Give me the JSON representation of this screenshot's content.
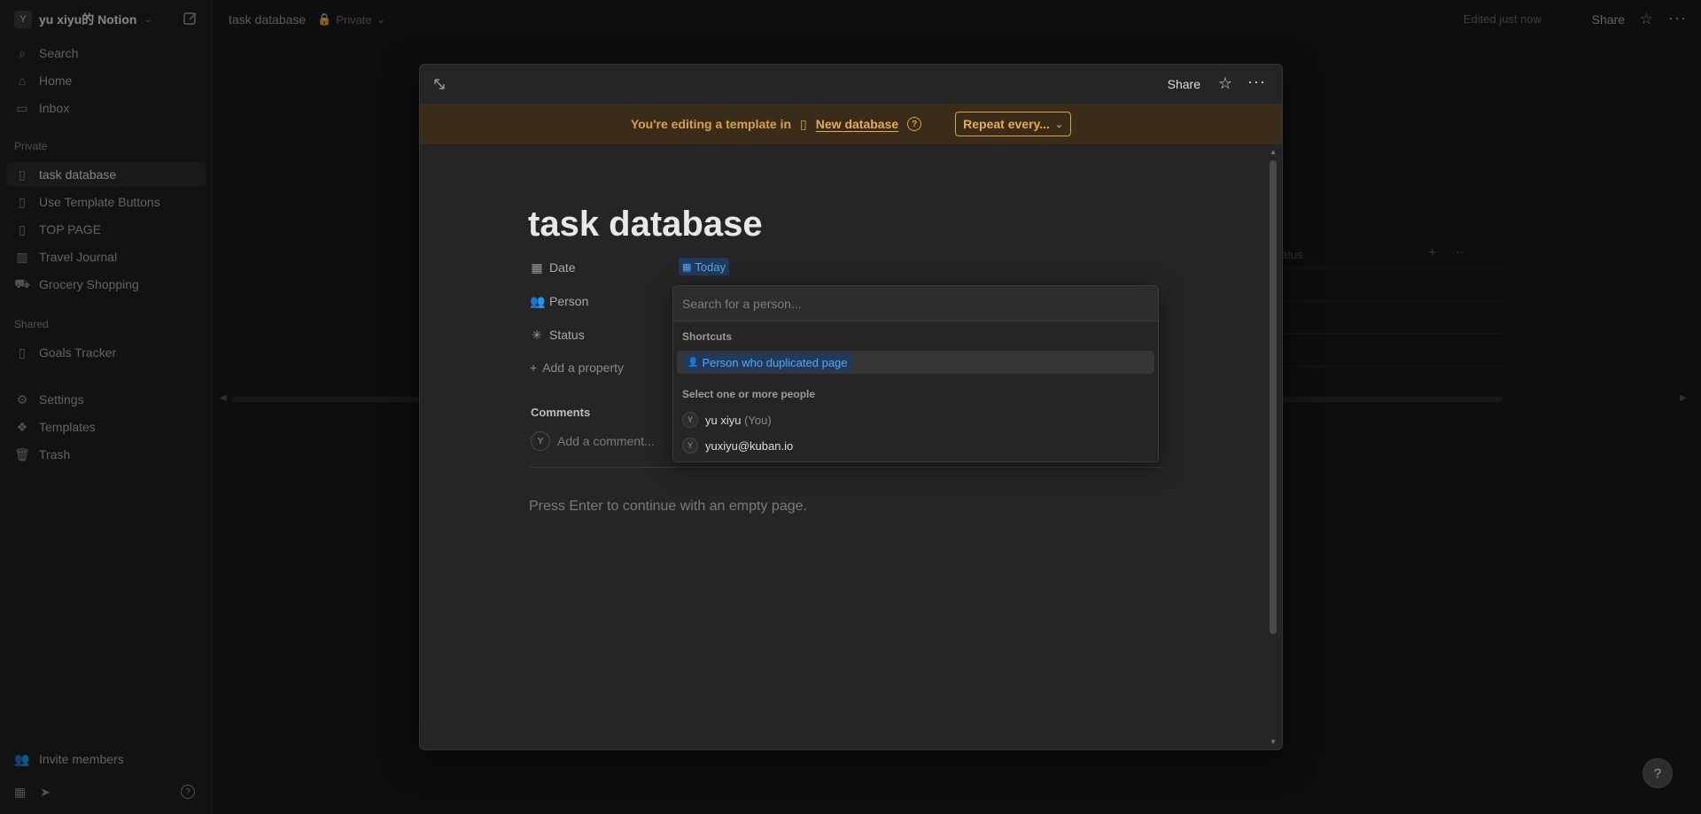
{
  "workspace": {
    "avatar": "Y",
    "name": "yu xiyu的 Notion"
  },
  "sidebar": {
    "top": [
      {
        "label": "Search",
        "icon": "search-icon"
      },
      {
        "label": "Home",
        "icon": "home-icon"
      },
      {
        "label": "Inbox",
        "icon": "inbox-icon"
      }
    ],
    "private_label": "Private",
    "private": [
      {
        "label": "task database",
        "active": true
      },
      {
        "label": "Use Template Buttons"
      },
      {
        "label": "TOP PAGE"
      },
      {
        "label": "Travel Journal"
      },
      {
        "label": "Grocery Shopping"
      }
    ],
    "shared_label": "Shared",
    "shared": [
      {
        "label": "Goals Tracker"
      }
    ],
    "utility": [
      {
        "label": "Settings"
      },
      {
        "label": "Templates"
      },
      {
        "label": "Trash"
      }
    ],
    "invite": "Invite members"
  },
  "topbar": {
    "breadcrumb": "task database",
    "privacy": "Private",
    "edited": "Edited just now",
    "share": "Share"
  },
  "background": {
    "status_header": "atus"
  },
  "modal": {
    "share": "Share",
    "banner": {
      "text": "You're editing a template in",
      "database": "New database",
      "repeat": "Repeat every..."
    },
    "title": "task database",
    "properties": [
      {
        "name": "Date"
      },
      {
        "name": "Person"
      },
      {
        "name": "Status"
      }
    ],
    "date_value": "Today",
    "add_property": "Add a property",
    "comments_label": "Comments",
    "comment_placeholder": "Add a comment...",
    "commenter_avatar": "Y",
    "empty_hint": "Press Enter to continue with an empty page."
  },
  "person_dropdown": {
    "search_placeholder": "Search for a person...",
    "shortcuts_label": "Shortcuts",
    "shortcut": "Person who duplicated page",
    "select_label": "Select one or more people",
    "people": [
      {
        "avatar": "Y",
        "name": "yu xiyu",
        "suffix": "(You)"
      },
      {
        "avatar": "Y",
        "name": "yuxiyu@kuban.io",
        "suffix": ""
      }
    ]
  }
}
